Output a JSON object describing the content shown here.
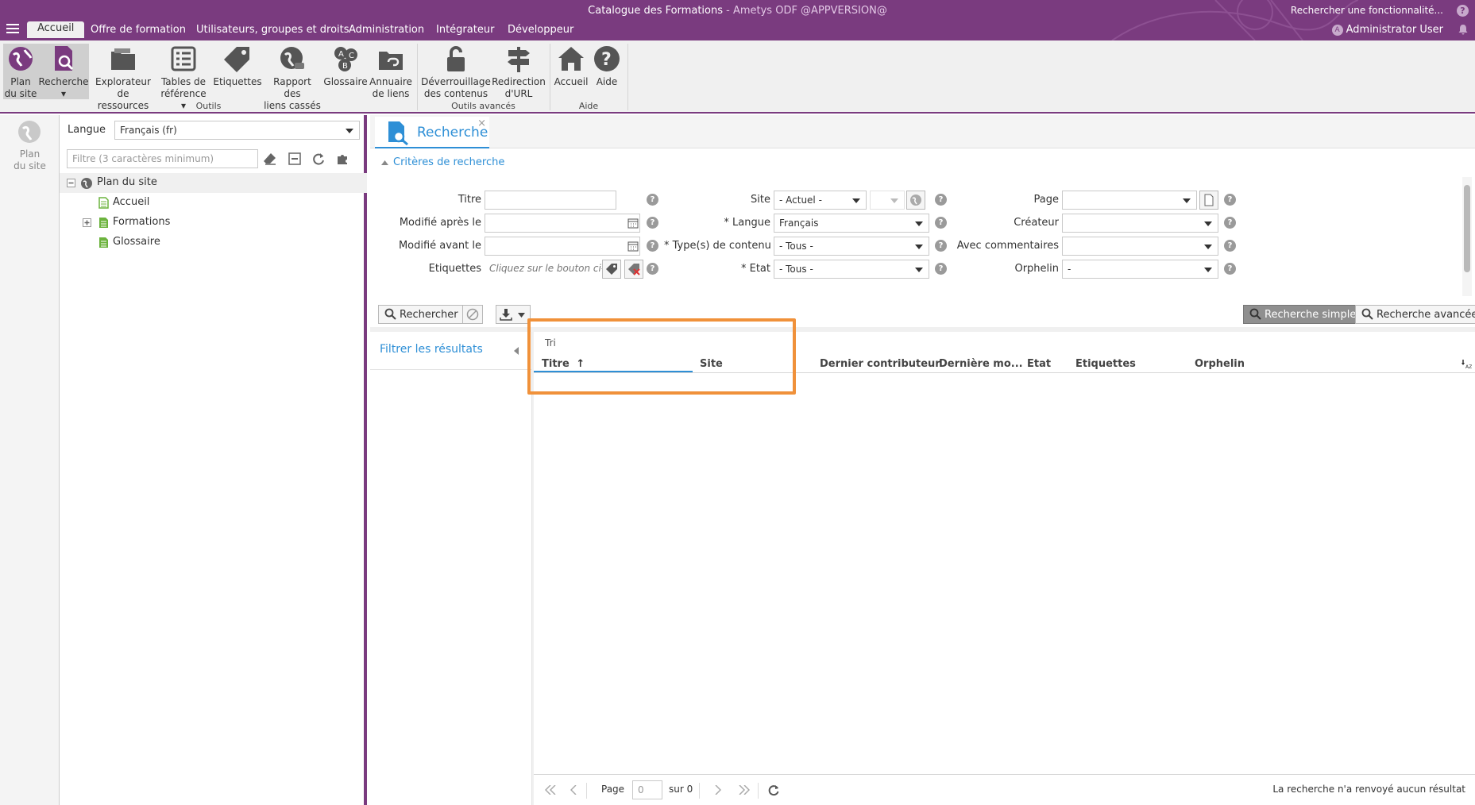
{
  "header": {
    "title_main": "Catalogue des Formations",
    "title_sub": " - Ametys ODF @APPVERSION@",
    "feature_search": "Rechercher une fonctionnalité...",
    "help": "?",
    "user_initial": "A",
    "user_name": "Administrator User",
    "menu_tabs": [
      "Accueil",
      "Offre de formation",
      "Utilisateurs, groupes et droits",
      "Administration",
      "Intégrateur",
      "Développeur"
    ]
  },
  "ribbon": {
    "buttons": [
      {
        "l1": "Plan",
        "l2": "du site"
      },
      {
        "l1": "Recherche",
        "l2": "▾"
      },
      {
        "l1": "Explorateur",
        "l2": "de ressources"
      },
      {
        "l1": "Tables de",
        "l2": "référence ▾"
      },
      {
        "l1": "Etiquettes",
        "l2": ""
      },
      {
        "l1": "Rapport des",
        "l2": "liens cassés"
      },
      {
        "l1": "Glossaire",
        "l2": ""
      },
      {
        "l1": "Annuaire",
        "l2": "de liens"
      },
      {
        "l1": "Déverrouillage",
        "l2": "des contenus"
      },
      {
        "l1": "Redirection",
        "l2": "d'URL"
      },
      {
        "l1": "Accueil",
        "l2": ""
      },
      {
        "l1": "Aide",
        "l2": ""
      }
    ],
    "groups": [
      "Outils",
      "Outils avancés",
      "Aide"
    ]
  },
  "collapsed_panel": {
    "l1": "Plan",
    "l2": "du site"
  },
  "sitemap": {
    "lang_label": "Langue",
    "lang_value": "Français (fr)",
    "filter_placeholder": "Filtre (3 caractères minimum)",
    "tree": {
      "root": "Plan du site",
      "children": [
        "Accueil",
        "Formations",
        "Glossaire"
      ]
    }
  },
  "main": {
    "tab_title": "Recherche",
    "tab_close": "×",
    "criteria_toggle": "Critères de recherche",
    "fields": {
      "titre": "Titre",
      "modifie_apres": "Modifié après le",
      "modifie_avant": "Modifié avant le",
      "etiquettes": "Etiquettes",
      "etiquettes_placeholder": "Cliquez sur le bouton ci-...",
      "site": "Site",
      "site_value": "- Actuel -",
      "langue": "* Langue",
      "langue_value": "Français",
      "types": "* Type(s) de contenu",
      "types_value": "- Tous -",
      "etat": "* Etat",
      "etat_value": "- Tous -",
      "page": "Page",
      "createur": "Créateur",
      "avec_commentaires": "Avec commentaires",
      "orphelin": "Orphelin",
      "orphelin_value": "-"
    },
    "buttons": {
      "search": "Rechercher",
      "simple": "Recherche simple",
      "advanced": "Recherche avancée"
    },
    "filter_results": "Filtrer les résultats",
    "sort_label": "Tri",
    "columns": [
      "Titre",
      "Site",
      "Dernier contributeur",
      "Dernière mo...",
      "Etat",
      "Etiquettes",
      "Orphelin"
    ],
    "sort_arrow": "↑",
    "pager": {
      "page_label": "Page",
      "page_value": "0",
      "of": "sur 0",
      "status": "La recherche n'a renvoyé aucun résultat"
    }
  },
  "colors": {
    "brand": "#7a3b7f",
    "accent": "#2e8fd6",
    "highlight": "#f0913a"
  }
}
